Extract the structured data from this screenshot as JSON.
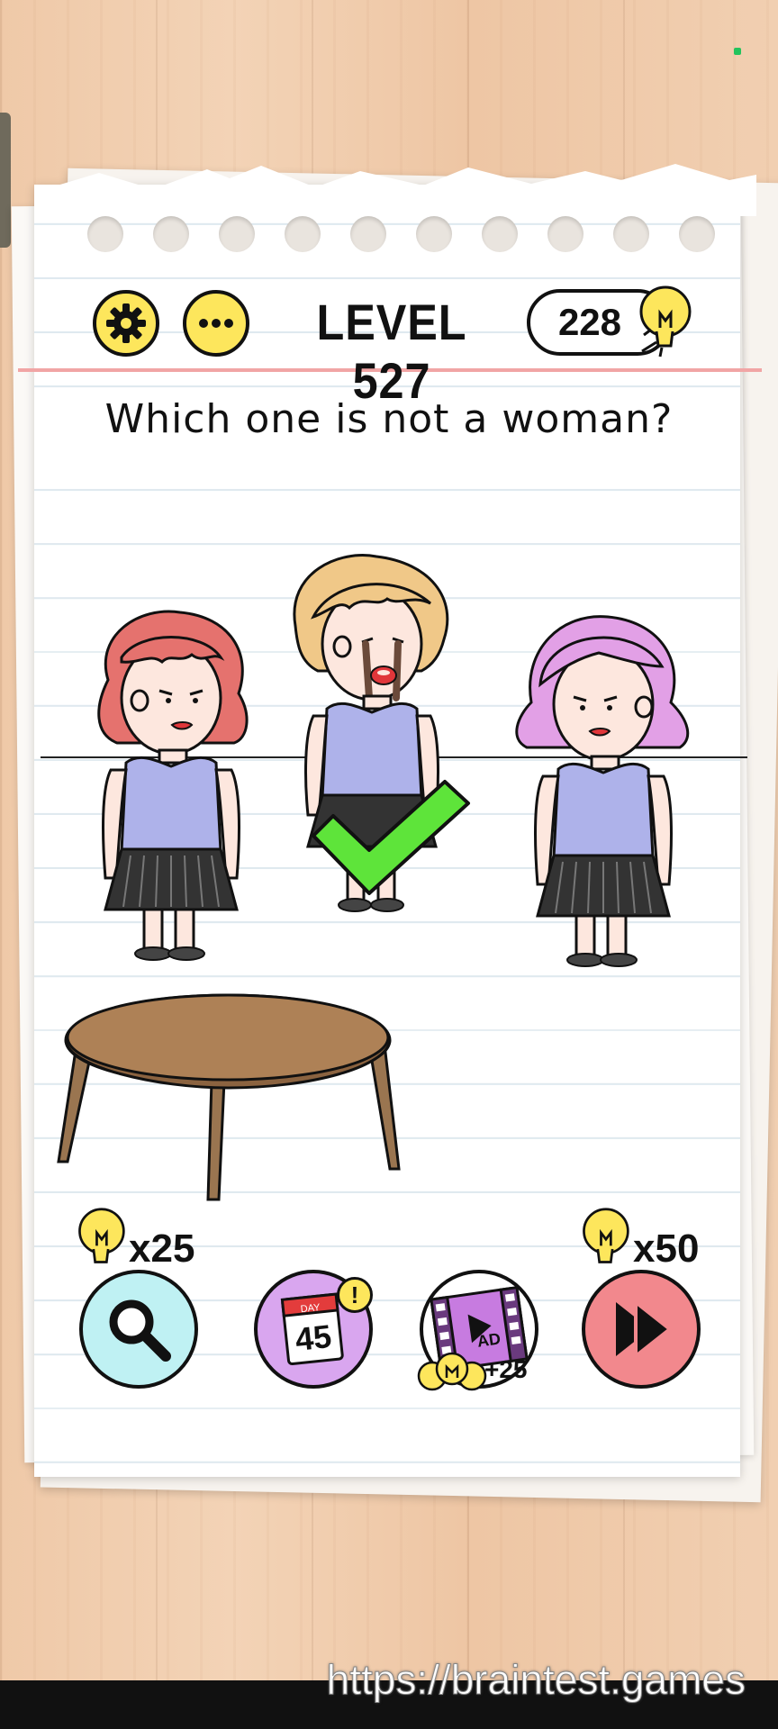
{
  "header": {
    "settings_icon": "gear-icon",
    "menu_icon": "ellipsis-icon",
    "level_label": "LEVEL 527",
    "hint_bulbs": "228",
    "bulb_icon": "lightbulb-icon"
  },
  "puzzle": {
    "question": "Which one is not a woman?",
    "answer_state": "correct",
    "characters": [
      {
        "name": "red-haired-woman",
        "hair_color": "#e5726e"
      },
      {
        "name": "crying-blond-person",
        "hair_color": "#f0c888"
      },
      {
        "name": "pink-haired-woman",
        "hair_color": "#e2a0e6"
      }
    ],
    "objects": [
      "table"
    ]
  },
  "toolbar": {
    "search": {
      "cost": "x25",
      "icon": "magnifier-icon"
    },
    "daily": {
      "day_label": "DAY",
      "day_number": "45",
      "badge": "!",
      "icon": "calendar-icon"
    },
    "watch_ad": {
      "label": "AD",
      "reward": "+25",
      "icon": "film-play-icon"
    },
    "skip": {
      "cost": "x50",
      "icon": "fast-forward-icon"
    }
  },
  "watermark": "https://braintest.games",
  "colors": {
    "accent_yellow": "#fde65c",
    "check_green": "#5ee43a",
    "search_bg": "#bff1f3",
    "daily_bg": "#d9a6ef",
    "skip_bg": "#f2888d"
  }
}
